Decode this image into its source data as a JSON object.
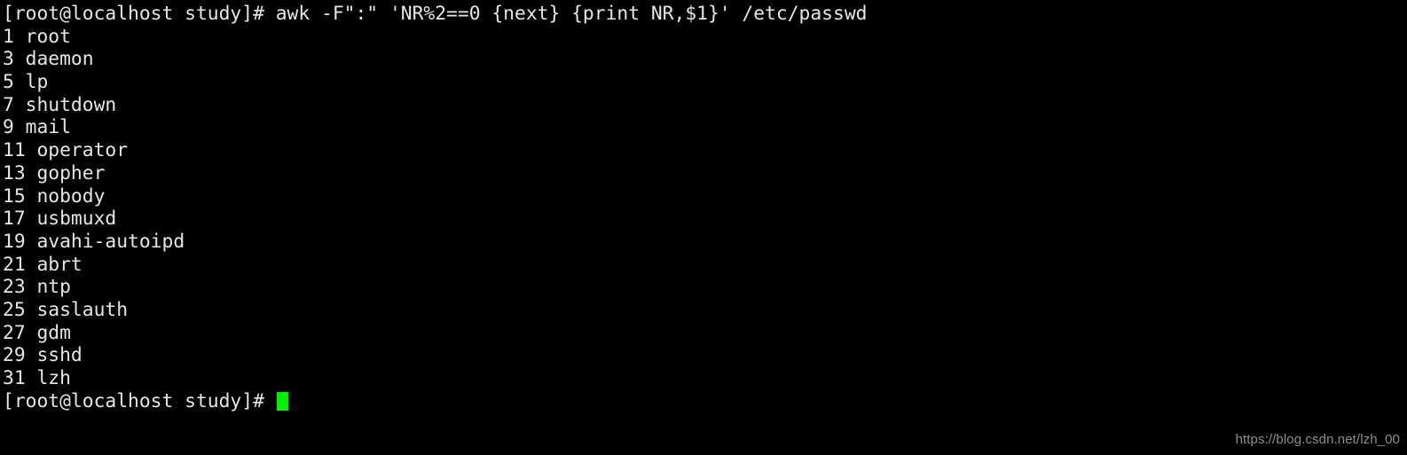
{
  "terminal": {
    "background_color": "#000000",
    "foreground_color": "#e6e6e6",
    "cursor_color": "#00ee00",
    "command_line": {
      "prompt": "[root@localhost study]# ",
      "command": "awk -F\":\" 'NR%2==0 {next} {print NR,$1}' /etc/passwd",
      "full_line": "[root@localhost study]# awk -F\":\" 'NR%2==0 {next} {print NR,$1}' /etc/passwd"
    },
    "output_lines": [
      "1 root",
      "3 daemon",
      "5 lp",
      "7 shutdown",
      "9 mail",
      "11 operator",
      "13 gopher",
      "15 nobody",
      "17 usbmuxd",
      "19 avahi-autoipd",
      "21 abrt",
      "23 ntp",
      "25 saslauth",
      "27 gdm",
      "29 sshd",
      "31 lzh"
    ],
    "final_prompt": {
      "prompt": "[root@localhost study]# ",
      "cursor": "block"
    }
  },
  "watermark": {
    "text": "https://blog.csdn.net/lzh_00",
    "color": "#8c8c8c"
  }
}
